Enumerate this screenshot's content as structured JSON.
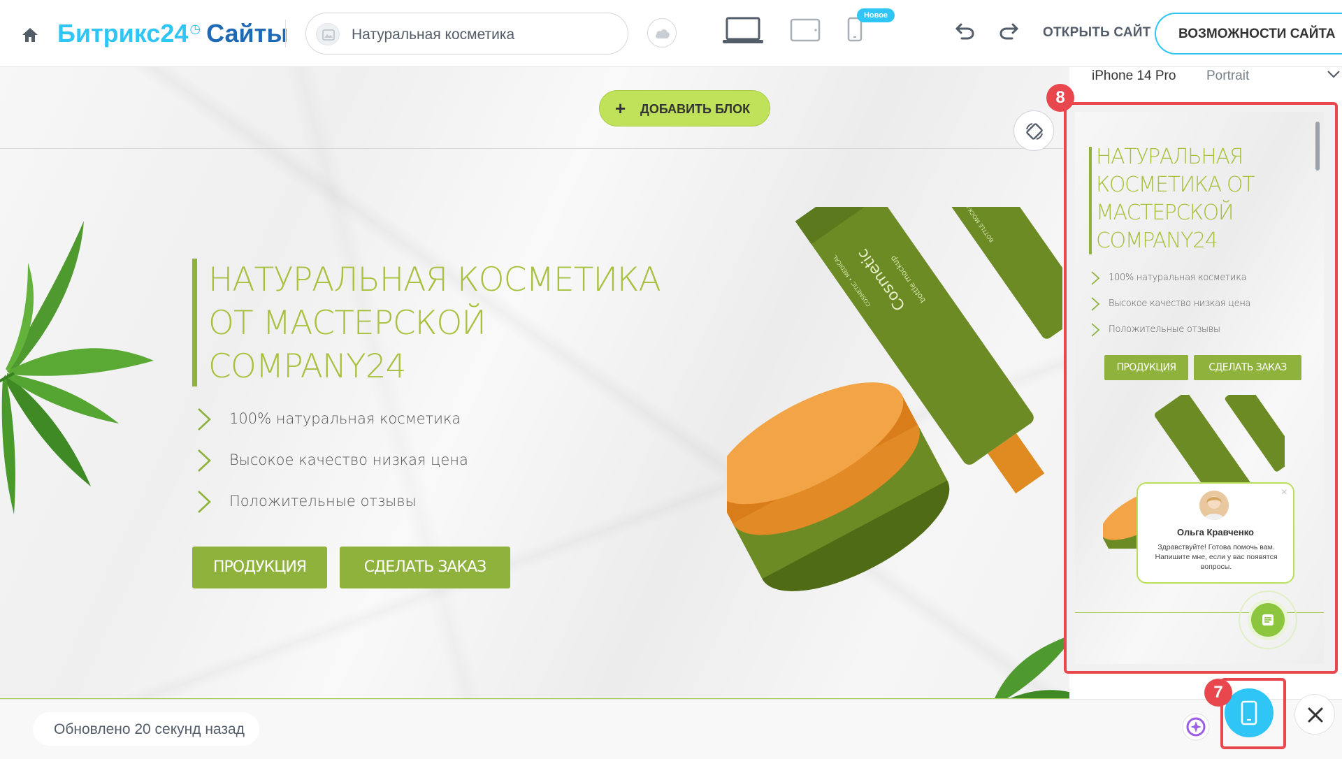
{
  "header": {
    "logo_brand": "Битрикс24",
    "logo_clock": "◷",
    "logo_product": "Сайты",
    "site_name": "Натуральная косметика",
    "new_badge": "Новое",
    "open_site": "ОТКРЫТЬ САЙТ",
    "features": "ВОЗМОЖНОСТИ САЙТА",
    "icons": [
      "home-icon",
      "cloud-icon",
      "desktop-icon",
      "tablet-icon",
      "phone-icon",
      "undo-icon",
      "redo-icon"
    ]
  },
  "editor": {
    "add_block_plus": "+",
    "add_block_label": "ДОБАВИТЬ БЛОК"
  },
  "hero": {
    "title_lines": [
      "НАТУРАЛЬНАЯ КОСМЕТИКА",
      "ОТ МАСТЕРСКОЙ",
      "COMPANY24"
    ],
    "bullets": [
      "100% натуральная косметика",
      "Высокое качество низкая цена",
      "Положительные отзывы"
    ],
    "button_products": "ПРОДУКЦИЯ",
    "button_order": "СДЕЛАТЬ ЗАКАЗ",
    "product_labels": [
      "Cosmetic",
      "bottle mockup",
      "COSMETIC • MEDICAL",
      "BOTTLE MOCK-UP"
    ]
  },
  "preview": {
    "device_name": "iPhone 14 Pro",
    "orientation": "Portrait",
    "title_lines": [
      "НАТУРАЛЬНАЯ",
      "КОСМЕТИКА ОТ",
      "МАСТЕРСКОЙ",
      "COMPANY24"
    ],
    "bullets": [
      "100% натуральная косметика",
      "Высокое качество низкая цена",
      "Положительные отзывы"
    ],
    "button_products": "ПРОДУКЦИЯ",
    "button_order": "СДЕЛАТЬ ЗАКАЗ",
    "chat": {
      "name": "Ольга Кравченко",
      "message": "Здравствуйте! Готова помочь вам. Напишите мне, если у вас появятся вопросы.",
      "close": "×"
    }
  },
  "annotations": {
    "badge_8": "8",
    "badge_7": "7"
  },
  "footer": {
    "updated": "Обновлено 20 секунд назад"
  },
  "colors": {
    "accent": "#2fc6f6",
    "brand_dark": "#1f6ab5",
    "leaf_green": "#8fb23c",
    "title_green": "#a7c13f",
    "add_block": "#bfe25a",
    "highlight": "#e8474d"
  }
}
